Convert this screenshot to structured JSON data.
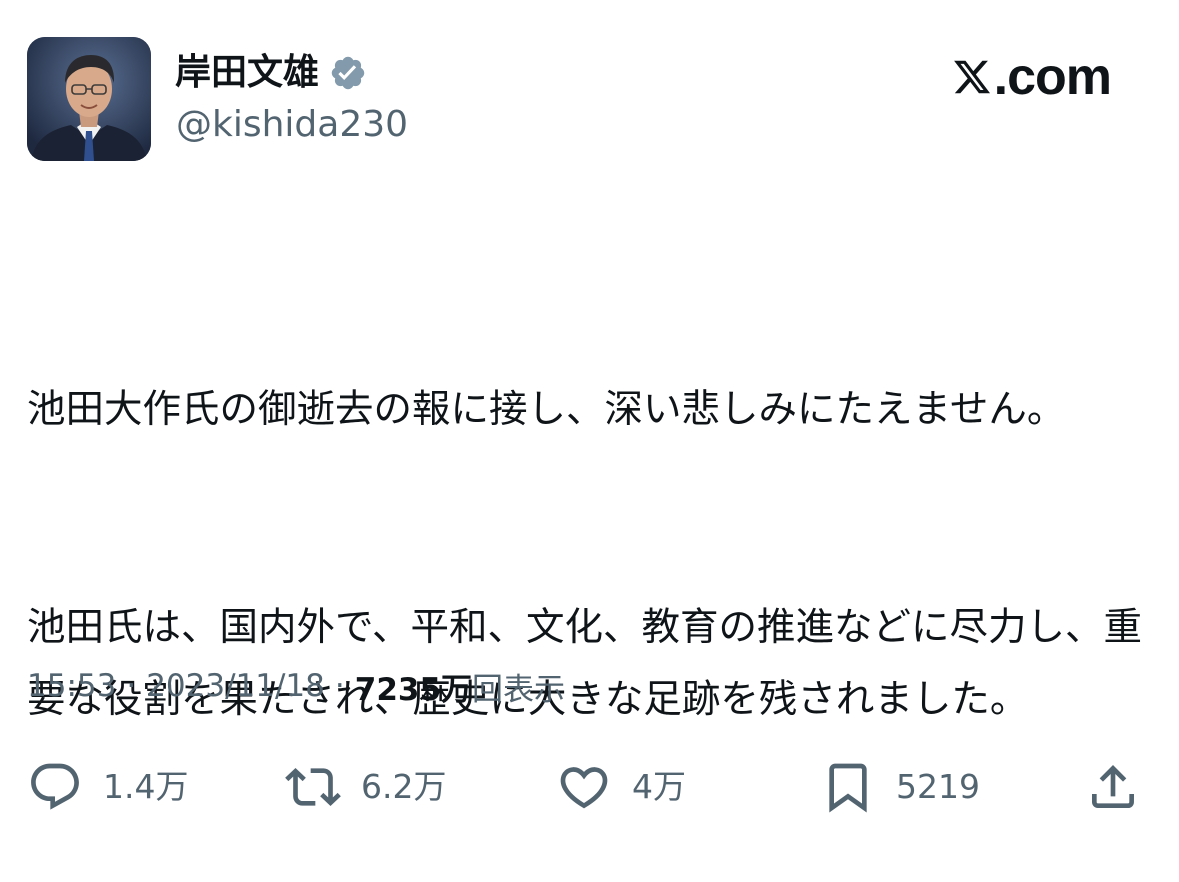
{
  "author": {
    "display_name": "岸田文雄",
    "handle": "@kishida230",
    "verified_icon": "verified-badge-icon",
    "avatar_icon": "profile-photo"
  },
  "brand": {
    "text": ".com",
    "logo_icon": "x-logo-icon"
  },
  "tweet": {
    "paragraphs": [
      "池田大作氏の御逝去の報に接し、深い悲しみにたえません。",
      "池田氏は、国内外で、平和、文化、教育の推進などに尽力し、重要な役割を果たされ、歴史に大きな足跡を残されました。"
    ]
  },
  "meta": {
    "time": "15:53",
    "separator": "·",
    "date": "2023/11/18",
    "views_count": "7235万",
    "views_label": "回表示"
  },
  "actions": {
    "reply": {
      "icon": "reply-icon",
      "count": "1.4万"
    },
    "repost": {
      "icon": "repost-icon",
      "count": "6.2万"
    },
    "like": {
      "icon": "heart-icon",
      "count": "4万"
    },
    "bookmark": {
      "icon": "bookmark-icon",
      "count": "5219"
    },
    "share": {
      "icon": "share-icon"
    }
  },
  "colors": {
    "text": "#0f1419",
    "secondary": "#536471",
    "verified": "#829aab",
    "background": "#ffffff"
  }
}
